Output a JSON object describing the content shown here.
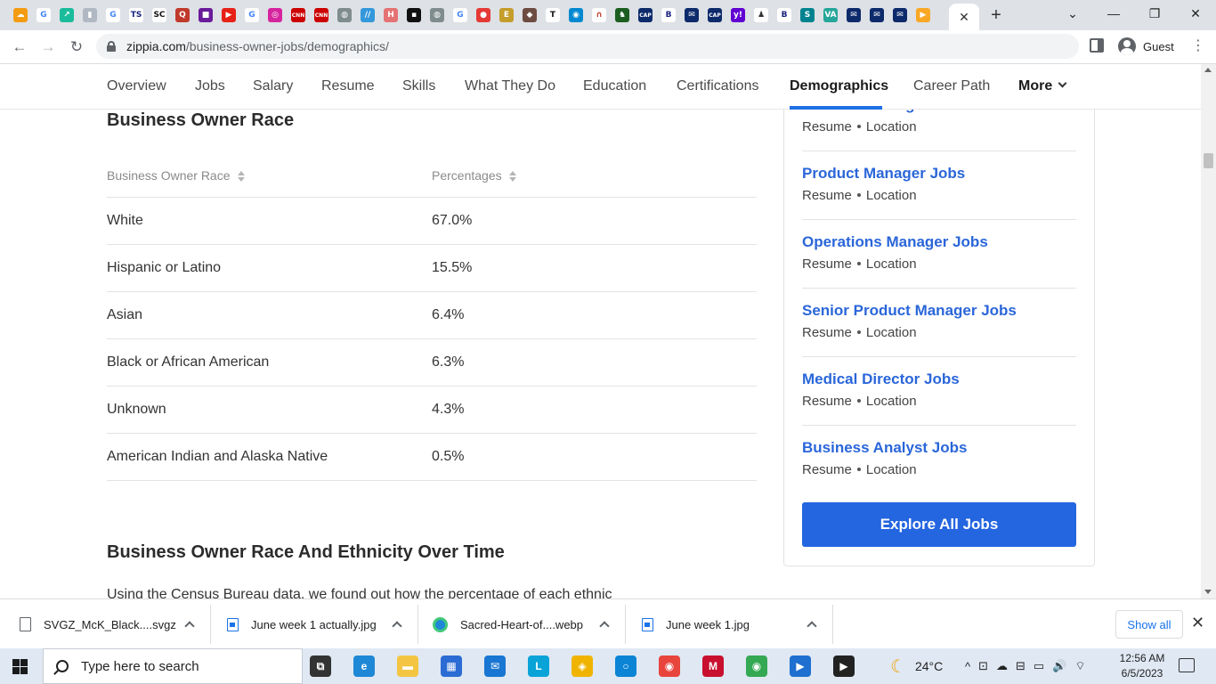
{
  "browser": {
    "bookmark_icons": [
      {
        "name": "cloud-app-icon",
        "color": "#f39c12",
        "glyph": "☁"
      },
      {
        "name": "google-icon",
        "color": "#ffffff",
        "glyph": "G",
        "text_color": "#4285f4"
      },
      {
        "name": "arrow-app-icon",
        "color": "#1abc9c",
        "glyph": "↗"
      },
      {
        "name": "bookmark-page-icon",
        "color": "#b0b8c4",
        "glyph": "▮"
      },
      {
        "name": "google-icon",
        "color": "#ffffff",
        "glyph": "G",
        "text_color": "#4285f4"
      },
      {
        "name": "ts-icon",
        "color": "#ffffff",
        "glyph": "TS",
        "text_color": "#1a237e"
      },
      {
        "name": "sc-icon",
        "color": "#ffffff",
        "glyph": "SC",
        "text_color": "#111"
      },
      {
        "name": "quora-icon",
        "color": "#c0392b",
        "glyph": "Q"
      },
      {
        "name": "purple-app-icon",
        "color": "#6a1b9a",
        "glyph": "■"
      },
      {
        "name": "youtube-icon",
        "color": "#e62117",
        "glyph": "▶"
      },
      {
        "name": "google-icon",
        "color": "#ffffff",
        "glyph": "G",
        "text_color": "#4285f4"
      },
      {
        "name": "instagram-icon",
        "color": "#d6249f",
        "glyph": "◎"
      },
      {
        "name": "cnn-icon",
        "color": "#cc0000",
        "glyph": "CNN"
      },
      {
        "name": "cnn-icon",
        "color": "#cc0000",
        "glyph": "CNN"
      },
      {
        "name": "globe-icon",
        "color": "#7f8c8d",
        "glyph": "◍"
      },
      {
        "name": "slash-app-icon",
        "color": "#3498db",
        "glyph": "//"
      },
      {
        "name": "h-app-icon",
        "color": "#e57373",
        "glyph": "H"
      },
      {
        "name": "black-square-icon",
        "color": "#111111",
        "glyph": "▪"
      },
      {
        "name": "globe-icon",
        "color": "#7f8c8d",
        "glyph": "◍"
      },
      {
        "name": "google-icon",
        "color": "#ffffff",
        "glyph": "G",
        "text_color": "#4285f4"
      },
      {
        "name": "red-circle-icon",
        "color": "#e53935",
        "glyph": "●"
      },
      {
        "name": "e-app-icon",
        "color": "#c59d2a",
        "glyph": "E"
      },
      {
        "name": "photo-app-icon",
        "color": "#6d4c41",
        "glyph": "◆"
      },
      {
        "name": "nyt-icon",
        "color": "#ffffff",
        "glyph": "T",
        "text_color": "#111"
      },
      {
        "name": "blue-circle-app-icon",
        "color": "#0288d1",
        "glyph": "◉"
      },
      {
        "name": "arch-app-icon",
        "color": "#ffffff",
        "glyph": "∩",
        "text_color": "#c0392b"
      },
      {
        "name": "spartan-icon",
        "color": "#1b5e20",
        "glyph": "♞"
      },
      {
        "name": "cap-icon",
        "color": "#0d2a6b",
        "glyph": "CAP"
      },
      {
        "name": "b-app-icon",
        "color": "#ffffff",
        "glyph": "B",
        "text_color": "#1a237e"
      },
      {
        "name": "mail-app-icon",
        "color": "#0d2a6b",
        "glyph": "✉"
      },
      {
        "name": "cap-icon",
        "color": "#0d2a6b",
        "glyph": "CAP"
      },
      {
        "name": "yahoo-icon",
        "color": "#6001d2",
        "glyph": "y!"
      },
      {
        "name": "figure-app-icon",
        "color": "#ffffff",
        "glyph": "♟",
        "text_color": "#333"
      },
      {
        "name": "b-app-icon",
        "color": "#ffffff",
        "glyph": "B",
        "text_color": "#1a237e"
      },
      {
        "name": "swirl-app-icon",
        "color": "#00838f",
        "glyph": "S"
      },
      {
        "name": "va-app-icon",
        "color": "#26a69a",
        "glyph": "VA"
      },
      {
        "name": "mail-app-icon",
        "color": "#0d2a6b",
        "glyph": "✉"
      },
      {
        "name": "mail-app-icon",
        "color": "#0d2a6b",
        "glyph": "✉"
      },
      {
        "name": "mail-app-icon",
        "color": "#0d2a6b",
        "glyph": "✉"
      },
      {
        "name": "yellow-app-icon",
        "color": "#f9a825",
        "glyph": "▶"
      }
    ],
    "active_tab_close": "✕",
    "new_tab": "+",
    "window_controls": {
      "tabsearch": "⌄",
      "minimize": "—",
      "restore": "❐",
      "close": "✕"
    },
    "nav": {
      "back": "←",
      "forward": "→",
      "reload": "↻"
    },
    "url_host": "zippia.com",
    "url_path": "/business-owner-jobs/demographics/",
    "profile_label": "Guest",
    "menu": "⋮"
  },
  "subnav": {
    "items": [
      "Overview",
      "Jobs",
      "Salary",
      "Resume",
      "Skills",
      "What They Do",
      "Education",
      "Certifications",
      "Demographics",
      "Career Path",
      "More"
    ],
    "active": "Demographics"
  },
  "main": {
    "section_title": "Business Owner Race",
    "table": {
      "headers": [
        "Business Owner Race",
        "Percentages"
      ],
      "rows": [
        [
          "White",
          "67.0%"
        ],
        [
          "Hispanic or Latino",
          "15.5%"
        ],
        [
          "Asian",
          "6.4%"
        ],
        [
          "Black or African American",
          "6.3%"
        ],
        [
          "Unknown",
          "4.3%"
        ],
        [
          "American Indian and Alaska Native",
          "0.5%"
        ]
      ]
    },
    "section2_title": "Business Owner Race And Ethnicity Over Time",
    "paragraph_start": "Using the Census Bureau data, we found out how the percentage of each ethnic"
  },
  "sidebar": {
    "jobs": [
      {
        "title": "Account Manager Jobs",
        "resume": "Resume",
        "location": "Location"
      },
      {
        "title": "Product Manager Jobs",
        "resume": "Resume",
        "location": "Location"
      },
      {
        "title": "Operations Manager Jobs",
        "resume": "Resume",
        "location": "Location"
      },
      {
        "title": "Senior Product Manager Jobs",
        "resume": "Resume",
        "location": "Location"
      },
      {
        "title": "Medical Director Jobs",
        "resume": "Resume",
        "location": "Location"
      },
      {
        "title": "Business Analyst Jobs",
        "resume": "Resume",
        "location": "Location"
      }
    ],
    "explore_label": "Explore All Jobs"
  },
  "downloads": {
    "items": [
      {
        "name": "SVGZ_McK_Black....svgz",
        "icon": "file-icon"
      },
      {
        "name": "June week 1 actually.jpg",
        "icon": "image-file-icon"
      },
      {
        "name": "Sacred-Heart-of....webp",
        "icon": "edge-icon"
      },
      {
        "name": "June week 1.jpg",
        "icon": "image-file-icon"
      }
    ],
    "show_all": "Show all",
    "close": "✕"
  },
  "taskbar": {
    "search_placeholder": "Type here to search",
    "pinned": [
      {
        "name": "task-view-icon",
        "color": "#333333",
        "glyph": "⧉"
      },
      {
        "name": "edge-icon",
        "color": "#1e88d6",
        "glyph": "e"
      },
      {
        "name": "file-explorer-icon",
        "color": "#f4c542",
        "glyph": "▬"
      },
      {
        "name": "store-icon",
        "color": "#2b6cd4",
        "glyph": "▦"
      },
      {
        "name": "mail-icon",
        "color": "#1976d2",
        "glyph": "✉"
      },
      {
        "name": "l-app-icon",
        "color": "#0aa3d8",
        "glyph": "L"
      },
      {
        "name": "yellow-app-icon",
        "color": "#f0b400",
        "glyph": "◈"
      },
      {
        "name": "blue-app-icon",
        "color": "#0b84d6",
        "glyph": "○"
      },
      {
        "name": "chrome-icon",
        "color": "#e8453c",
        "glyph": "◉"
      },
      {
        "name": "mcafee-icon",
        "color": "#c8102e",
        "glyph": "M"
      },
      {
        "name": "chrome-icon",
        "color": "#34a853",
        "glyph": "◉"
      },
      {
        "name": "video-app-icon",
        "color": "#1e6fd0",
        "glyph": "▶"
      },
      {
        "name": "media-player-icon",
        "color": "#222222",
        "glyph": "▶"
      }
    ],
    "weather_icon": "☾",
    "temperature": "24°C",
    "tray_icons": [
      "^",
      "⊡",
      "☁",
      "⊟",
      "▭",
      "🔊",
      "⌔"
    ],
    "time": "12:56 AM",
    "date": "6/5/2023"
  }
}
